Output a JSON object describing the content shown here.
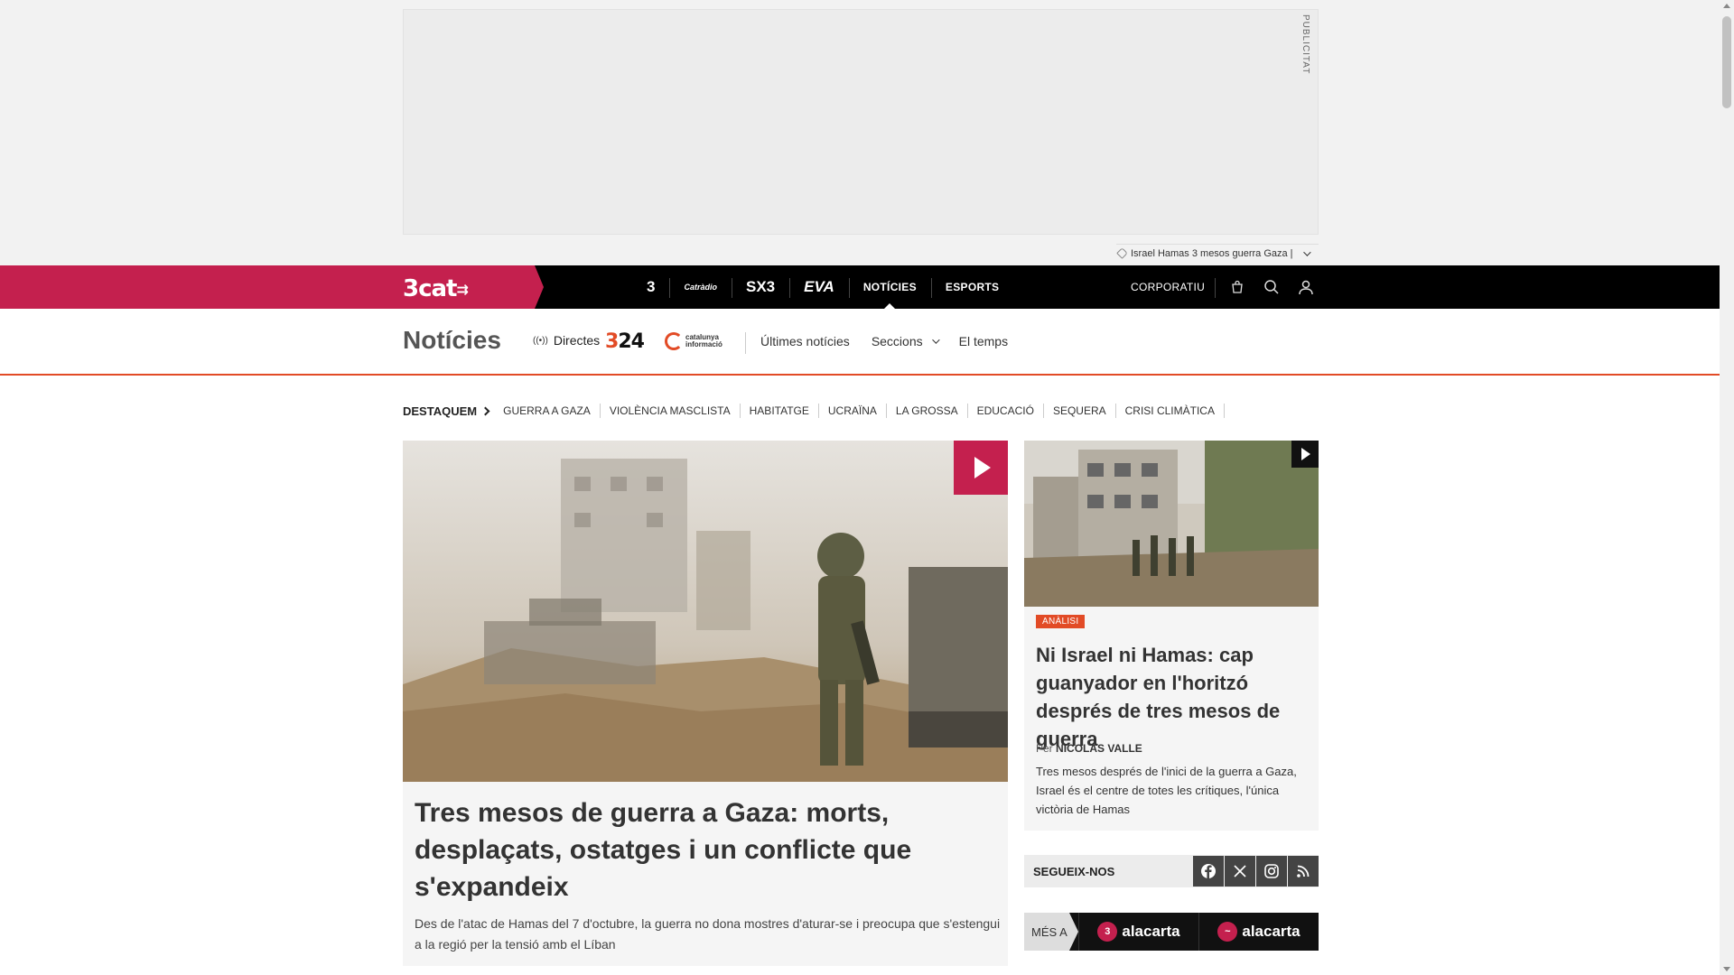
{
  "ad": {
    "label": "PUBLICITAT"
  },
  "trending": {
    "text": "Israel Hamas 3 mesos guerra Gaza |"
  },
  "topnav": {
    "brand": "3cat",
    "channels": [
      {
        "label": "3",
        "name": "channel-tv3"
      },
      {
        "label": "Catràdio",
        "name": "channel-catradio"
      },
      {
        "label": "SX3",
        "name": "channel-sx3"
      },
      {
        "label": "EVA",
        "name": "channel-eva"
      },
      {
        "label": "NOTÍCIES",
        "name": "channel-noticies"
      },
      {
        "label": "ESPORTS",
        "name": "channel-esports"
      }
    ],
    "corporatiu": "CORPORATIU"
  },
  "section": {
    "title": "Notícies",
    "directes": "Directes",
    "logo_324_a": "3",
    "logo_324_b": "24",
    "catinfo_text": "catalunya informació",
    "links": {
      "ultimes": "Últimes notícies",
      "seccions": "Seccions",
      "temps": "El temps"
    }
  },
  "highlights": {
    "label": "DESTAQUEM",
    "items": [
      "GUERRA A GAZA",
      "VIOLÈNCIA MASCLISTA",
      "HABITATGE",
      "UCRAÏNA",
      "LA GROSSA",
      "EDUCACIÓ",
      "SEQUERA",
      "CRISI CLIMÀTICA"
    ]
  },
  "main_article": {
    "headline": "Tres mesos de guerra a Gaza: morts, desplaçats, ostatges i un conflicte que s'expandeix",
    "summary": "Des de l'atac de Hamas del 7 d'octubre, la guerra no dona mostres d'aturar-se i preocupa que s'estengui a la regió per la tensió amb el Líban"
  },
  "side_article": {
    "badge": "ANÀLISI",
    "headline": "Ni Israel ni Hamas: cap guanyador en l'horitzó després de tres mesos de guerra",
    "byline_prefix": "Per",
    "author": "NICOLÁS VALLE",
    "summary": "Tres mesos després de l'inici de la guerra a Gaza, Israel és el centre de totes les crítiques, l'única victòria de Hamas"
  },
  "follow": {
    "label": "SEGUEIX-NOS"
  },
  "mes_a": {
    "label": "MÉS A",
    "item1": "alacarta",
    "item2": "alacarta"
  },
  "colors": {
    "brand": "#c4204e",
    "accent": "#e24b26",
    "nav_bg": "#000000"
  }
}
